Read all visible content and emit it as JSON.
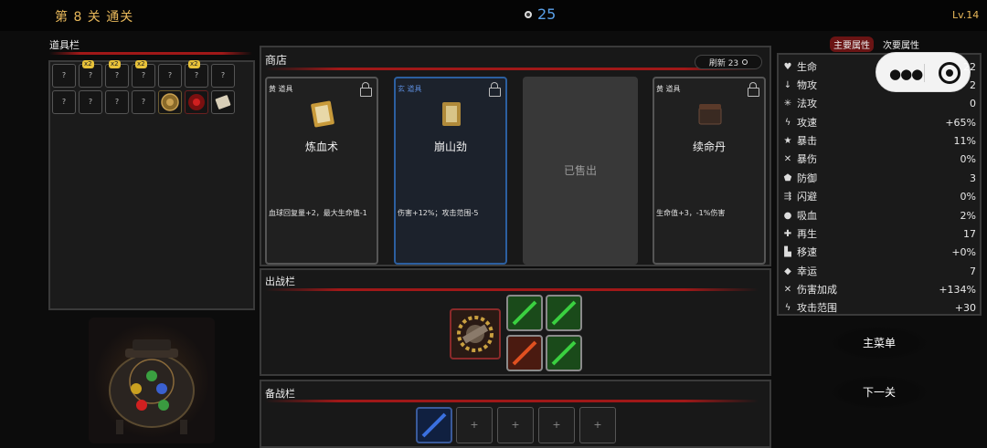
{
  "header": {
    "stage": "第 8 关 通关",
    "coins": "25",
    "level": "Lv.14"
  },
  "inventory": {
    "title": "道具栏",
    "row1": [
      {
        "label": "?",
        "badge": ""
      },
      {
        "label": "?",
        "badge": "x2"
      },
      {
        "label": "?",
        "badge": "x2"
      },
      {
        "label": "?",
        "badge": "x2"
      },
      {
        "label": "?",
        "badge": ""
      },
      {
        "label": "?",
        "badge": "x2"
      },
      {
        "label": "?",
        "badge": ""
      }
    ],
    "row2": [
      {
        "label": "?"
      },
      {
        "label": "?"
      },
      {
        "label": "?"
      },
      {
        "label": "?"
      }
    ]
  },
  "shop": {
    "title": "商店",
    "refresh": "刷新 23",
    "cards": [
      {
        "quality": "黄",
        "type": "道具",
        "name": "炼血术",
        "desc": "血球回复量+2，最大生命值-1"
      },
      {
        "quality": "玄",
        "type": "道具",
        "name": "崩山劲",
        "desc": "伤害+12%；攻击范围-5"
      },
      {
        "quality": "黄",
        "type": "道具",
        "name": "续命丹",
        "desc": "生命值+3，-1%伤害"
      }
    ],
    "sold_label": "已售出"
  },
  "battle": {
    "title": "出战栏"
  },
  "bench": {
    "title": "备战栏",
    "empty": [
      "+",
      "+",
      "+",
      "+"
    ]
  },
  "tabs": {
    "primary": "主要属性",
    "secondary": "次要属性"
  },
  "stats": [
    {
      "icon": "heart-icon",
      "glyph": "♥",
      "name": "生命",
      "value": "22"
    },
    {
      "icon": "sword-icon",
      "glyph": "↓",
      "name": "物攻",
      "value": "2"
    },
    {
      "icon": "magic-icon",
      "glyph": "✳",
      "name": "法攻",
      "value": "0"
    },
    {
      "icon": "bolt-icon",
      "glyph": "ϟ",
      "name": "攻速",
      "value": "+65%"
    },
    {
      "icon": "star-icon",
      "glyph": "★",
      "name": "暴击",
      "value": "11%"
    },
    {
      "icon": "cross-icon",
      "glyph": "✕",
      "name": "暴伤",
      "value": "0%"
    },
    {
      "icon": "shield-icon",
      "glyph": "⬟",
      "name": "防御",
      "value": "3"
    },
    {
      "icon": "dodge-icon",
      "glyph": "⇶",
      "name": "闪避",
      "value": "0%"
    },
    {
      "icon": "drop-icon",
      "glyph": "●",
      "name": "吸血",
      "value": "2%"
    },
    {
      "icon": "plus-icon",
      "glyph": "✚",
      "name": "再生",
      "value": "17"
    },
    {
      "icon": "boot-icon",
      "glyph": "▙",
      "name": "移速",
      "value": "+0%"
    },
    {
      "icon": "clover-icon",
      "glyph": "◆",
      "name": "幸运",
      "value": "7"
    },
    {
      "icon": "swords-icon",
      "glyph": "✕",
      "name": "伤害加成",
      "value": "+134%"
    },
    {
      "icon": "range-icon",
      "glyph": "ϟ",
      "name": "攻击范围",
      "value": "+30"
    }
  ],
  "buttons": {
    "main_menu": "主菜单",
    "next": "下一关"
  }
}
